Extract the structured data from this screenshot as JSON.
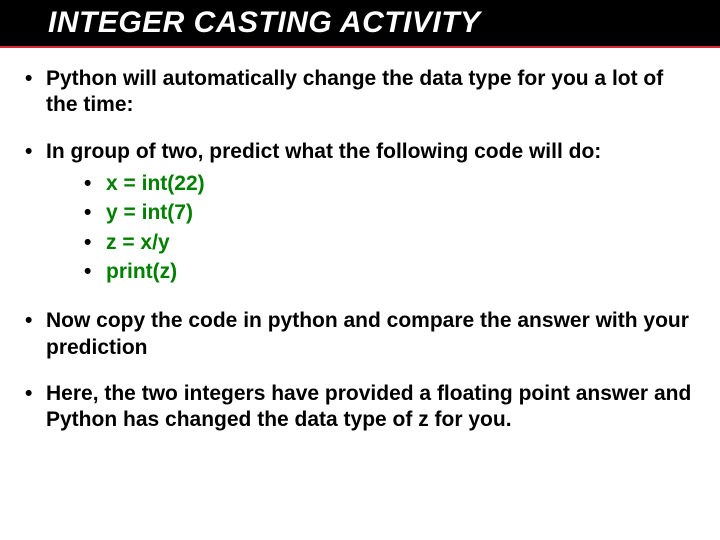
{
  "title": "INTEGER CASTING ACTIVITY",
  "bullets": {
    "b1": "Python will automatically change the data type for you a lot of the time:",
    "b2": "In group of two, predict what the following code will do:",
    "code": {
      "l1": "x = int(22)",
      "l2": "y = int(7)",
      "l3": "z = x/y",
      "l4": "print(z)"
    },
    "b3": "Now copy the code in python and compare the answer with your prediction",
    "b4": "Here, the two integers have provided a floating point answer and Python has changed the data type of z for you."
  }
}
